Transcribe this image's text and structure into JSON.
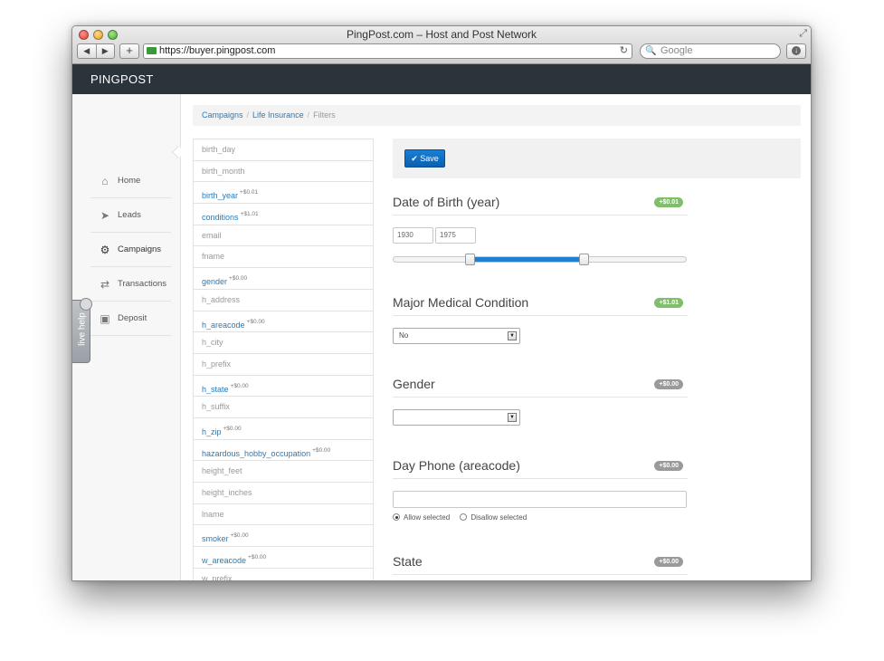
{
  "window": {
    "title": "PingPost.com – Host and Post Network"
  },
  "browser": {
    "url": "https://buyer.pingpost.com",
    "search_placeholder": "Google",
    "back_icon": "◀",
    "forward_icon": "▶",
    "new_tab_icon": "+",
    "reload_icon": "↻",
    "search_icon": "🔍"
  },
  "header": {
    "brand": "PINGPOST"
  },
  "sidebar": {
    "items": [
      {
        "label": "Home",
        "icon": "home-icon",
        "glyph": "⌂"
      },
      {
        "label": "Leads",
        "icon": "location-arrow-icon",
        "glyph": "➤"
      },
      {
        "label": "Campaigns",
        "icon": "gears-icon",
        "glyph": "⚙",
        "active": true
      },
      {
        "label": "Transactions",
        "icon": "exchange-icon",
        "glyph": "⇄"
      },
      {
        "label": "Deposit",
        "icon": "money-icon",
        "glyph": "▣"
      }
    ],
    "live_help": "live help"
  },
  "breadcrumb": {
    "items": [
      "Campaigns",
      "Life Insurance"
    ],
    "current": "Filters",
    "separator": "/"
  },
  "fields": [
    {
      "name": "birth_day",
      "price": "",
      "linked": false
    },
    {
      "name": "birth_month",
      "price": "",
      "linked": false
    },
    {
      "name": "birth_year",
      "price": "+$0.01",
      "linked": true
    },
    {
      "name": "conditions",
      "price": "+$1.01",
      "linked": true
    },
    {
      "name": "email",
      "price": "",
      "linked": false
    },
    {
      "name": "fname",
      "price": "",
      "linked": false
    },
    {
      "name": "gender",
      "price": "+$0.00",
      "linked": true
    },
    {
      "name": "h_address",
      "price": "",
      "linked": false
    },
    {
      "name": "h_areacode",
      "price": "+$0.00",
      "linked": true
    },
    {
      "name": "h_city",
      "price": "",
      "linked": false
    },
    {
      "name": "h_prefix",
      "price": "",
      "linked": false
    },
    {
      "name": "h_state",
      "price": "+$0.00",
      "linked": true
    },
    {
      "name": "h_suffix",
      "price": "",
      "linked": false
    },
    {
      "name": "h_zip",
      "price": "+$0.00",
      "linked": true
    },
    {
      "name": "hazardous_hobby_occupation",
      "price": "+$0.00",
      "linked": true
    },
    {
      "name": "height_feet",
      "price": "",
      "linked": false
    },
    {
      "name": "height_inches",
      "price": "",
      "linked": false
    },
    {
      "name": "lname",
      "price": "",
      "linked": false
    },
    {
      "name": "smoker",
      "price": "+$0.00",
      "linked": true
    },
    {
      "name": "w_areacode",
      "price": "+$0.00",
      "linked": true
    },
    {
      "name": "w_prefix",
      "price": "",
      "linked": false
    }
  ],
  "save_button": {
    "label": "Save",
    "icon": "check-icon"
  },
  "filters": {
    "dob": {
      "title": "Date of Birth (year)",
      "badge": "+$0.01",
      "badge_color": "#7fbf6a",
      "from": "1930",
      "to": "1975",
      "slider_range_start": 0.26,
      "slider_range_end": 0.65
    },
    "medical": {
      "title": "Major Medical Condition",
      "badge": "+$1.01",
      "badge_color": "#7fbf6a",
      "selected": "No"
    },
    "gender": {
      "title": "Gender",
      "badge": "+$0.00",
      "badge_color": "#9a9a9a",
      "selected": ""
    },
    "areacode": {
      "title": "Day Phone (areacode)",
      "badge": "+$0.00",
      "badge_color": "#9a9a9a",
      "value": "",
      "allow_label": "Allow selected",
      "disallow_label": "Disallow selected",
      "allow_checked": true
    },
    "state": {
      "title": "State",
      "badge": "+$0.00",
      "badge_color": "#9a9a9a"
    }
  },
  "colors": {
    "link": "#2a7ab8",
    "topbar": "#2b333b",
    "accent": "#1f7fd0"
  }
}
